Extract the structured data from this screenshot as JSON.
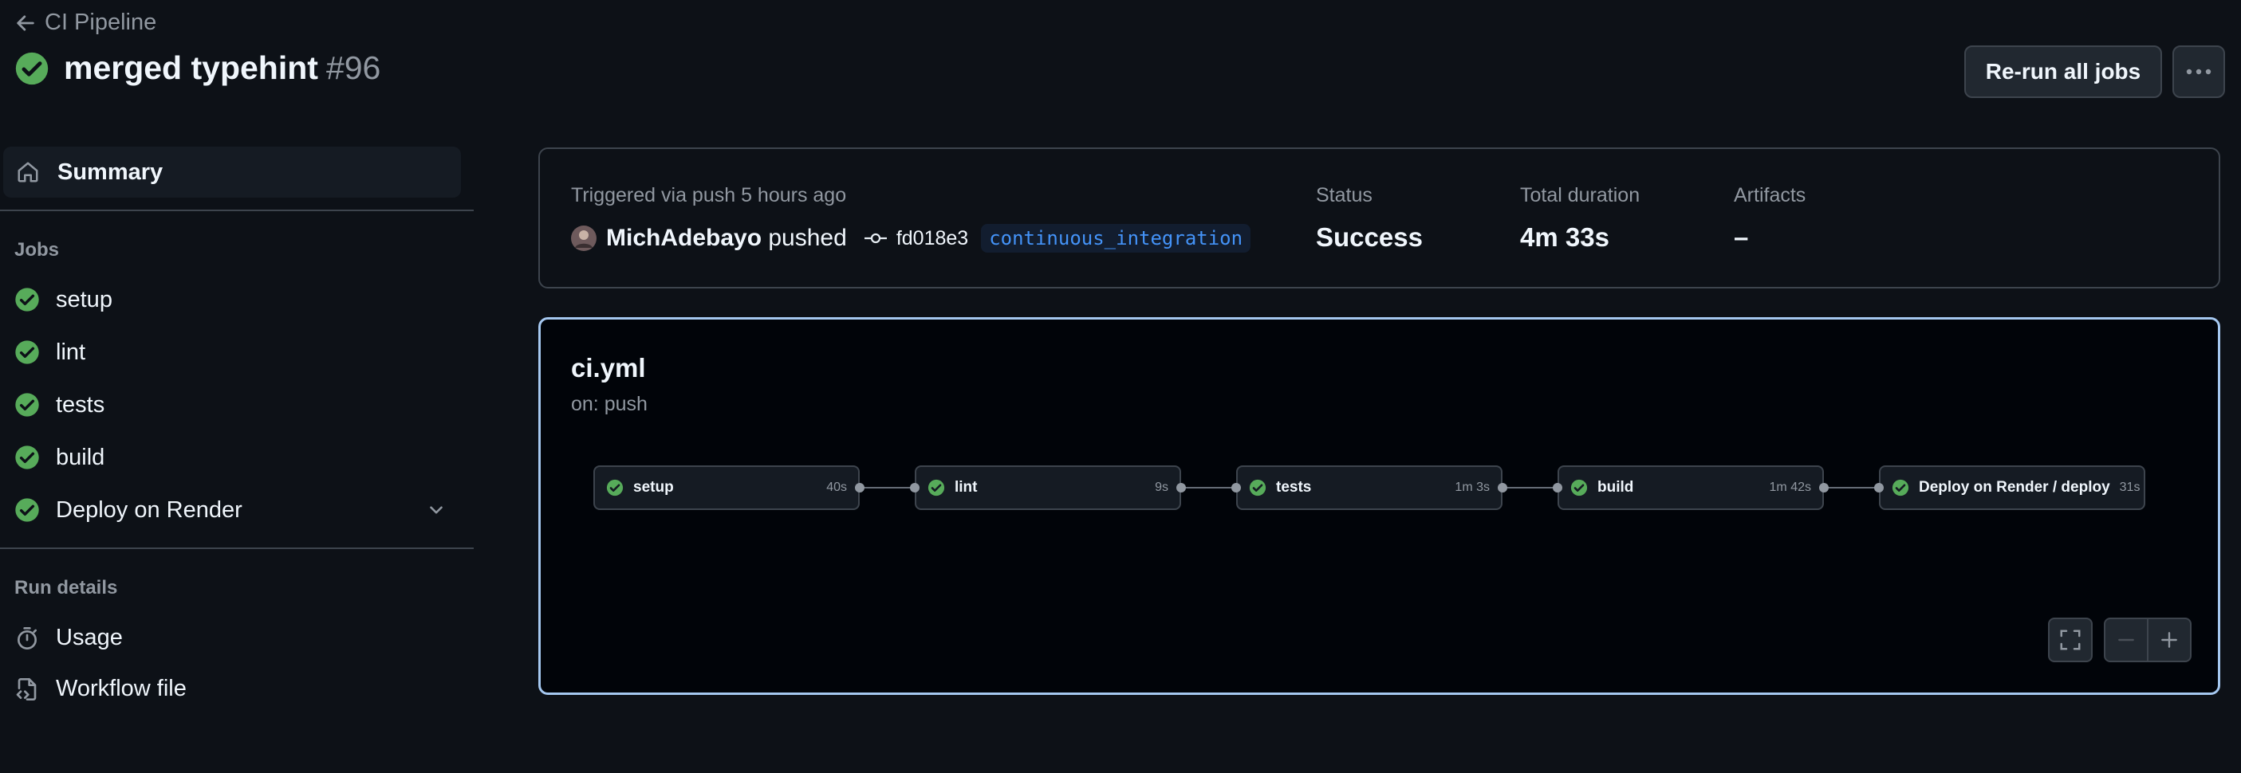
{
  "header": {
    "back_label": "CI Pipeline",
    "title": "merged typehint",
    "run_number": "#96",
    "rerun_label": "Re-run all jobs"
  },
  "sidebar": {
    "summary_label": "Summary",
    "jobs_heading": "Jobs",
    "jobs": [
      {
        "label": "setup"
      },
      {
        "label": "lint"
      },
      {
        "label": "tests"
      },
      {
        "label": "build"
      },
      {
        "label": "Deploy on Render"
      }
    ],
    "run_details_heading": "Run details",
    "run_details": [
      {
        "label": "Usage",
        "icon": "stopwatch-icon"
      },
      {
        "label": "Workflow file",
        "icon": "file-code-icon"
      }
    ]
  },
  "status": {
    "trigger_text": "Triggered via push 5 hours ago",
    "actor": "MichAdebayo",
    "action": "pushed",
    "commit": "fd018e3",
    "branch": "continuous_integration",
    "status_label": "Status",
    "status_value": "Success",
    "duration_label": "Total duration",
    "duration_value": "4m 33s",
    "artifacts_label": "Artifacts",
    "artifacts_value": "–"
  },
  "workflow": {
    "file": "ci.yml",
    "trigger": "on: push",
    "nodes": [
      {
        "name": "setup",
        "duration": "40s"
      },
      {
        "name": "lint",
        "duration": "9s"
      },
      {
        "name": "tests",
        "duration": "1m 3s"
      },
      {
        "name": "build",
        "duration": "1m 42s"
      },
      {
        "name": "Deploy on Render / deploy",
        "duration": "31s"
      }
    ]
  },
  "colors": {
    "success": "#57ab5a",
    "accent_border": "#a5c8f0",
    "background": "#0d1117"
  }
}
